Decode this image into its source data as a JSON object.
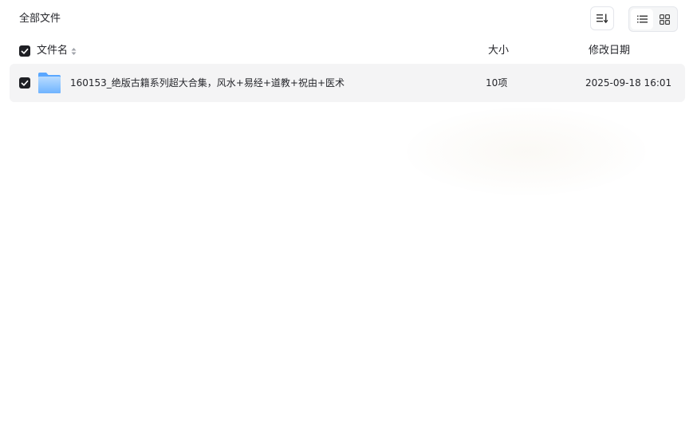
{
  "breadcrumb": {
    "title": "全部文件"
  },
  "toolbar": {
    "sort_icon": "sort-descending-icon",
    "view_list_icon": "list-view-icon",
    "view_grid_icon": "grid-view-icon",
    "active_view": "list"
  },
  "table": {
    "columns": {
      "name": "文件名",
      "size": "大小",
      "date": "修改日期"
    },
    "header_checked": true,
    "rows": [
      {
        "checked": true,
        "icon": "folder-icon",
        "name": "160153_绝版古籍系列超大合集，风水+易经+道教+祝由+医术",
        "size": "10项",
        "modified": "2025-09-18 16:01"
      }
    ]
  },
  "colors": {
    "checkbox": "#1f2025",
    "row_selected_bg": "#f4f4f5",
    "folder_light": "#a9d3ff",
    "folder_dark": "#5aa7ff"
  }
}
